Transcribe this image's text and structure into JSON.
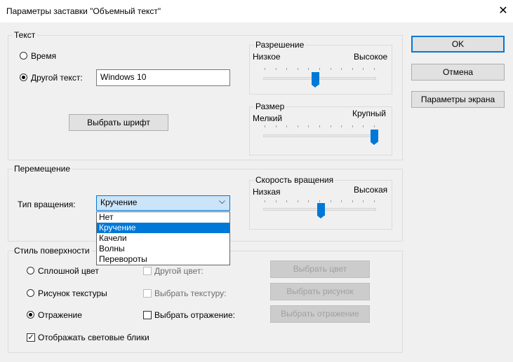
{
  "window": {
    "title": "Параметры заставки \"Объемный текст\"",
    "close_glyph": "✕"
  },
  "text_group": {
    "label": "Текст",
    "radio_time": "Время",
    "radio_other": "Другой текст:",
    "other_text_value": "Windows 10",
    "font_button": "Выбрать шрифт",
    "resolution": {
      "label": "Разрешение",
      "low": "Низкое",
      "high": "Высокое",
      "level": 0.45
    },
    "size": {
      "label": "Размер",
      "small": "Мелкий",
      "large": "Крупный",
      "level": 1.0
    }
  },
  "motion_group": {
    "label": "Перемещение",
    "rotation_type_label": "Тип вращения:",
    "rotation_type_selected": "Кручение",
    "rotation_options": [
      "Нет",
      "Кручение",
      "Качели",
      "Волны",
      "Перевороты"
    ],
    "speed": {
      "label": "Скорость вращения",
      "low": "Низкая",
      "high": "Высокая",
      "level": 0.5
    }
  },
  "surface_group": {
    "label": "Стиль поверхности",
    "radio_solid": "Сплошной цвет",
    "radio_texture": "Рисунок текстуры",
    "radio_reflection": "Отражение",
    "check_other_color": "Другой цвет:",
    "check_choose_texture": "Выбрать текстуру:",
    "check_choose_reflection": "Выбрать отражение:",
    "btn_choose_color": "Выбрать цвет",
    "btn_choose_picture": "Выбрать рисунок",
    "btn_choose_reflection": "Выбрать отражение",
    "check_highlights": "Отображать световые блики",
    "check_mark": "✓"
  },
  "buttons": {
    "ok": "OK",
    "cancel": "Отмена",
    "display_settings": "Параметры экрана"
  },
  "colors": {
    "accent": "#0078d7",
    "background": "#f0f0f0"
  }
}
